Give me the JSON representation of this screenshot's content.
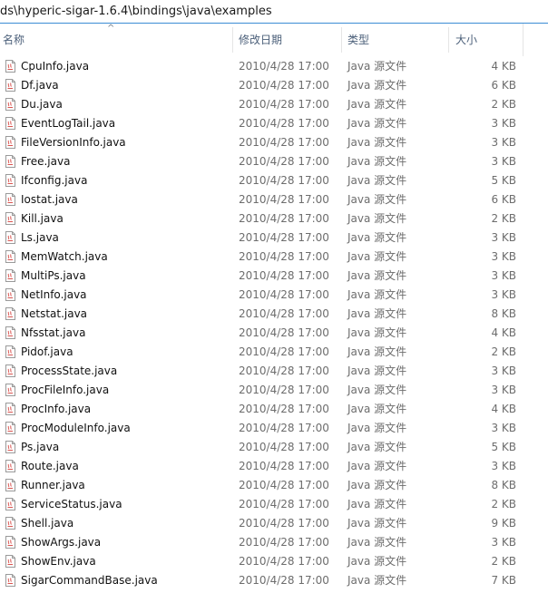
{
  "address": {
    "path": "ds\\hyperic-sigar-1.6.4\\bindings\\java\\examples"
  },
  "columns": {
    "name": "名称",
    "date": "修改日期",
    "type": "类型",
    "size": "大小"
  },
  "icons": {
    "sort": "sort-ascending-icon",
    "file": "java-file-icon"
  },
  "colors": {
    "accent": "#3c8dd4",
    "header_text": "#4c607a",
    "icon_red": "#d9534f"
  },
  "files": [
    {
      "name": "CpuInfo.java",
      "date": "2010/4/28 17:00",
      "type": "Java 源文件",
      "size": "4 KB"
    },
    {
      "name": "Df.java",
      "date": "2010/4/28 17:00",
      "type": "Java 源文件",
      "size": "6 KB"
    },
    {
      "name": "Du.java",
      "date": "2010/4/28 17:00",
      "type": "Java 源文件",
      "size": "2 KB"
    },
    {
      "name": "EventLogTail.java",
      "date": "2010/4/28 17:00",
      "type": "Java 源文件",
      "size": "3 KB"
    },
    {
      "name": "FileVersionInfo.java",
      "date": "2010/4/28 17:00",
      "type": "Java 源文件",
      "size": "3 KB"
    },
    {
      "name": "Free.java",
      "date": "2010/4/28 17:00",
      "type": "Java 源文件",
      "size": "3 KB"
    },
    {
      "name": "Ifconfig.java",
      "date": "2010/4/28 17:00",
      "type": "Java 源文件",
      "size": "5 KB"
    },
    {
      "name": "Iostat.java",
      "date": "2010/4/28 17:00",
      "type": "Java 源文件",
      "size": "6 KB"
    },
    {
      "name": "Kill.java",
      "date": "2010/4/28 17:00",
      "type": "Java 源文件",
      "size": "2 KB"
    },
    {
      "name": "Ls.java",
      "date": "2010/4/28 17:00",
      "type": "Java 源文件",
      "size": "3 KB"
    },
    {
      "name": "MemWatch.java",
      "date": "2010/4/28 17:00",
      "type": "Java 源文件",
      "size": "3 KB"
    },
    {
      "name": "MultiPs.java",
      "date": "2010/4/28 17:00",
      "type": "Java 源文件",
      "size": "3 KB"
    },
    {
      "name": "NetInfo.java",
      "date": "2010/4/28 17:00",
      "type": "Java 源文件",
      "size": "3 KB"
    },
    {
      "name": "Netstat.java",
      "date": "2010/4/28 17:00",
      "type": "Java 源文件",
      "size": "8 KB"
    },
    {
      "name": "Nfsstat.java",
      "date": "2010/4/28 17:00",
      "type": "Java 源文件",
      "size": "4 KB"
    },
    {
      "name": "Pidof.java",
      "date": "2010/4/28 17:00",
      "type": "Java 源文件",
      "size": "2 KB"
    },
    {
      "name": "ProcessState.java",
      "date": "2010/4/28 17:00",
      "type": "Java 源文件",
      "size": "3 KB"
    },
    {
      "name": "ProcFileInfo.java",
      "date": "2010/4/28 17:00",
      "type": "Java 源文件",
      "size": "3 KB"
    },
    {
      "name": "ProcInfo.java",
      "date": "2010/4/28 17:00",
      "type": "Java 源文件",
      "size": "4 KB"
    },
    {
      "name": "ProcModuleInfo.java",
      "date": "2010/4/28 17:00",
      "type": "Java 源文件",
      "size": "3 KB"
    },
    {
      "name": "Ps.java",
      "date": "2010/4/28 17:00",
      "type": "Java 源文件",
      "size": "5 KB"
    },
    {
      "name": "Route.java",
      "date": "2010/4/28 17:00",
      "type": "Java 源文件",
      "size": "3 KB"
    },
    {
      "name": "Runner.java",
      "date": "2010/4/28 17:00",
      "type": "Java 源文件",
      "size": "8 KB"
    },
    {
      "name": "ServiceStatus.java",
      "date": "2010/4/28 17:00",
      "type": "Java 源文件",
      "size": "2 KB"
    },
    {
      "name": "Shell.java",
      "date": "2010/4/28 17:00",
      "type": "Java 源文件",
      "size": "9 KB"
    },
    {
      "name": "ShowArgs.java",
      "date": "2010/4/28 17:00",
      "type": "Java 源文件",
      "size": "3 KB"
    },
    {
      "name": "ShowEnv.java",
      "date": "2010/4/28 17:00",
      "type": "Java 源文件",
      "size": "2 KB"
    },
    {
      "name": "SigarCommandBase.java",
      "date": "2010/4/28 17:00",
      "type": "Java 源文件",
      "size": "7 KB"
    }
  ]
}
